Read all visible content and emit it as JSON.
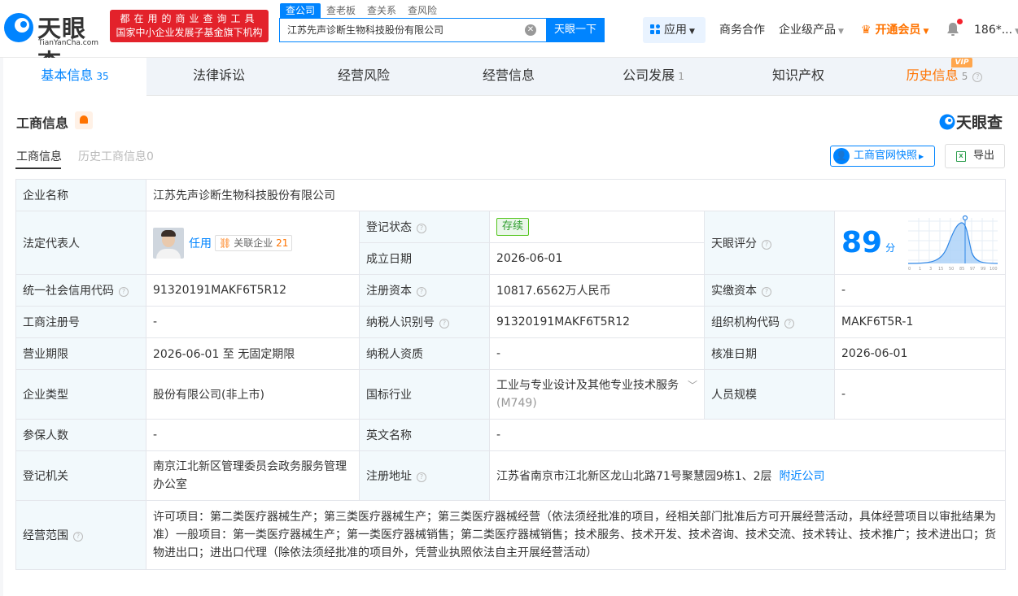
{
  "header": {
    "logo_cn": "天眼查",
    "logo_en": "TianYanCha.com",
    "slogan_line1": "都在用的商业查询工具",
    "slogan_line2": "国家中小企业发展子基金旗下机构",
    "search_tabs": [
      "查公司",
      "查老板",
      "查关系",
      "查风险"
    ],
    "search_value": "江苏先声诊断生物科技股份有限公司",
    "search_button": "天眼一下",
    "app_label": "应用",
    "nav_items": [
      "商务合作",
      "企业级产品",
      "开通会员"
    ],
    "user": "186*..."
  },
  "tabs": [
    {
      "label": "基本信息",
      "count": "35"
    },
    {
      "label": "法律诉讼",
      "count": ""
    },
    {
      "label": "经营风险",
      "count": ""
    },
    {
      "label": "经营信息",
      "count": ""
    },
    {
      "label": "公司发展",
      "count": "1"
    },
    {
      "label": "知识产权",
      "count": ""
    },
    {
      "label": "历史信息",
      "count": "5"
    }
  ],
  "vip_badge": "VIP",
  "panel": {
    "title": "工商信息",
    "watermark": "天眼查",
    "subtab_active": "工商信息",
    "subtab_history": "历史工商信息0",
    "snapshot_button": "工商官网快照",
    "export_button": "导出"
  },
  "info": {
    "company_name_label": "企业名称",
    "company_name": "江苏先声诊断生物科技股份有限公司",
    "legal_rep_label": "法定代表人",
    "legal_rep": "任用",
    "related_label": "关联企业",
    "related_count": "21",
    "reg_status_label": "登记状态",
    "reg_status": "存续",
    "found_date_label": "成立日期",
    "found_date": "2026-06-01",
    "score_label": "天眼评分",
    "score": "89",
    "score_unit": "分",
    "score_axis": [
      "0",
      "1",
      "3",
      "15",
      "50",
      "85",
      "97",
      "99",
      "100"
    ],
    "credit_code_label": "统一社会信用代码",
    "credit_code": "91320191MAKF6T5R12",
    "reg_capital_label": "注册资本",
    "reg_capital": "10817.6562万人民币",
    "paid_capital_label": "实缴资本",
    "paid_capital": "-",
    "reg_no_label": "工商注册号",
    "reg_no": "-",
    "taxpayer_id_label": "纳税人识别号",
    "taxpayer_id": "91320191MAKF6T5R12",
    "org_code_label": "组织机构代码",
    "org_code": "MAKF6T5R-1",
    "term_label": "营业期限",
    "term": "2026-06-01 至 无固定期限",
    "taxpayer_qual_label": "纳税人资质",
    "taxpayer_qual": "-",
    "approve_date_label": "核准日期",
    "approve_date": "2026-06-01",
    "type_label": "企业类型",
    "type": "股份有限公司(非上市)",
    "industry_label": "国标行业",
    "industry": "工业与专业设计及其他专业技术服务",
    "industry_code": "(M749)",
    "staff_label": "人员规模",
    "staff": "-",
    "insured_label": "参保人数",
    "insured": "-",
    "en_name_label": "英文名称",
    "en_name": "-",
    "authority_label": "登记机关",
    "authority": "南京江北新区管理委员会政务服务管理办公室",
    "address_label": "注册地址",
    "address": "江苏省南京市江北新区龙山北路71号聚慧园9栋1、2层",
    "nearby": "附近公司",
    "scope_label": "经营范围",
    "scope": "许可项目：第二类医疗器械生产；第三类医疗器械生产；第三类医疗器械经营（依法须经批准的项目，经相关部门批准后方可开展经营活动，具体经营项目以审批结果为准）一般项目：第一类医疗器械生产；第一类医疗器械销售；第二类医疗器械销售；技术服务、技术开发、技术咨询、技术交流、技术转让、技术推广；技术进出口；货物进出口；进出口代理（除依法须经批准的项目外，凭营业执照依法自主开展经营活动）"
  },
  "colors": {
    "brand": "#0084ff",
    "slogan_bg": "#e3222b",
    "vip": "#ff7300",
    "status_green": "#52c41a"
  }
}
